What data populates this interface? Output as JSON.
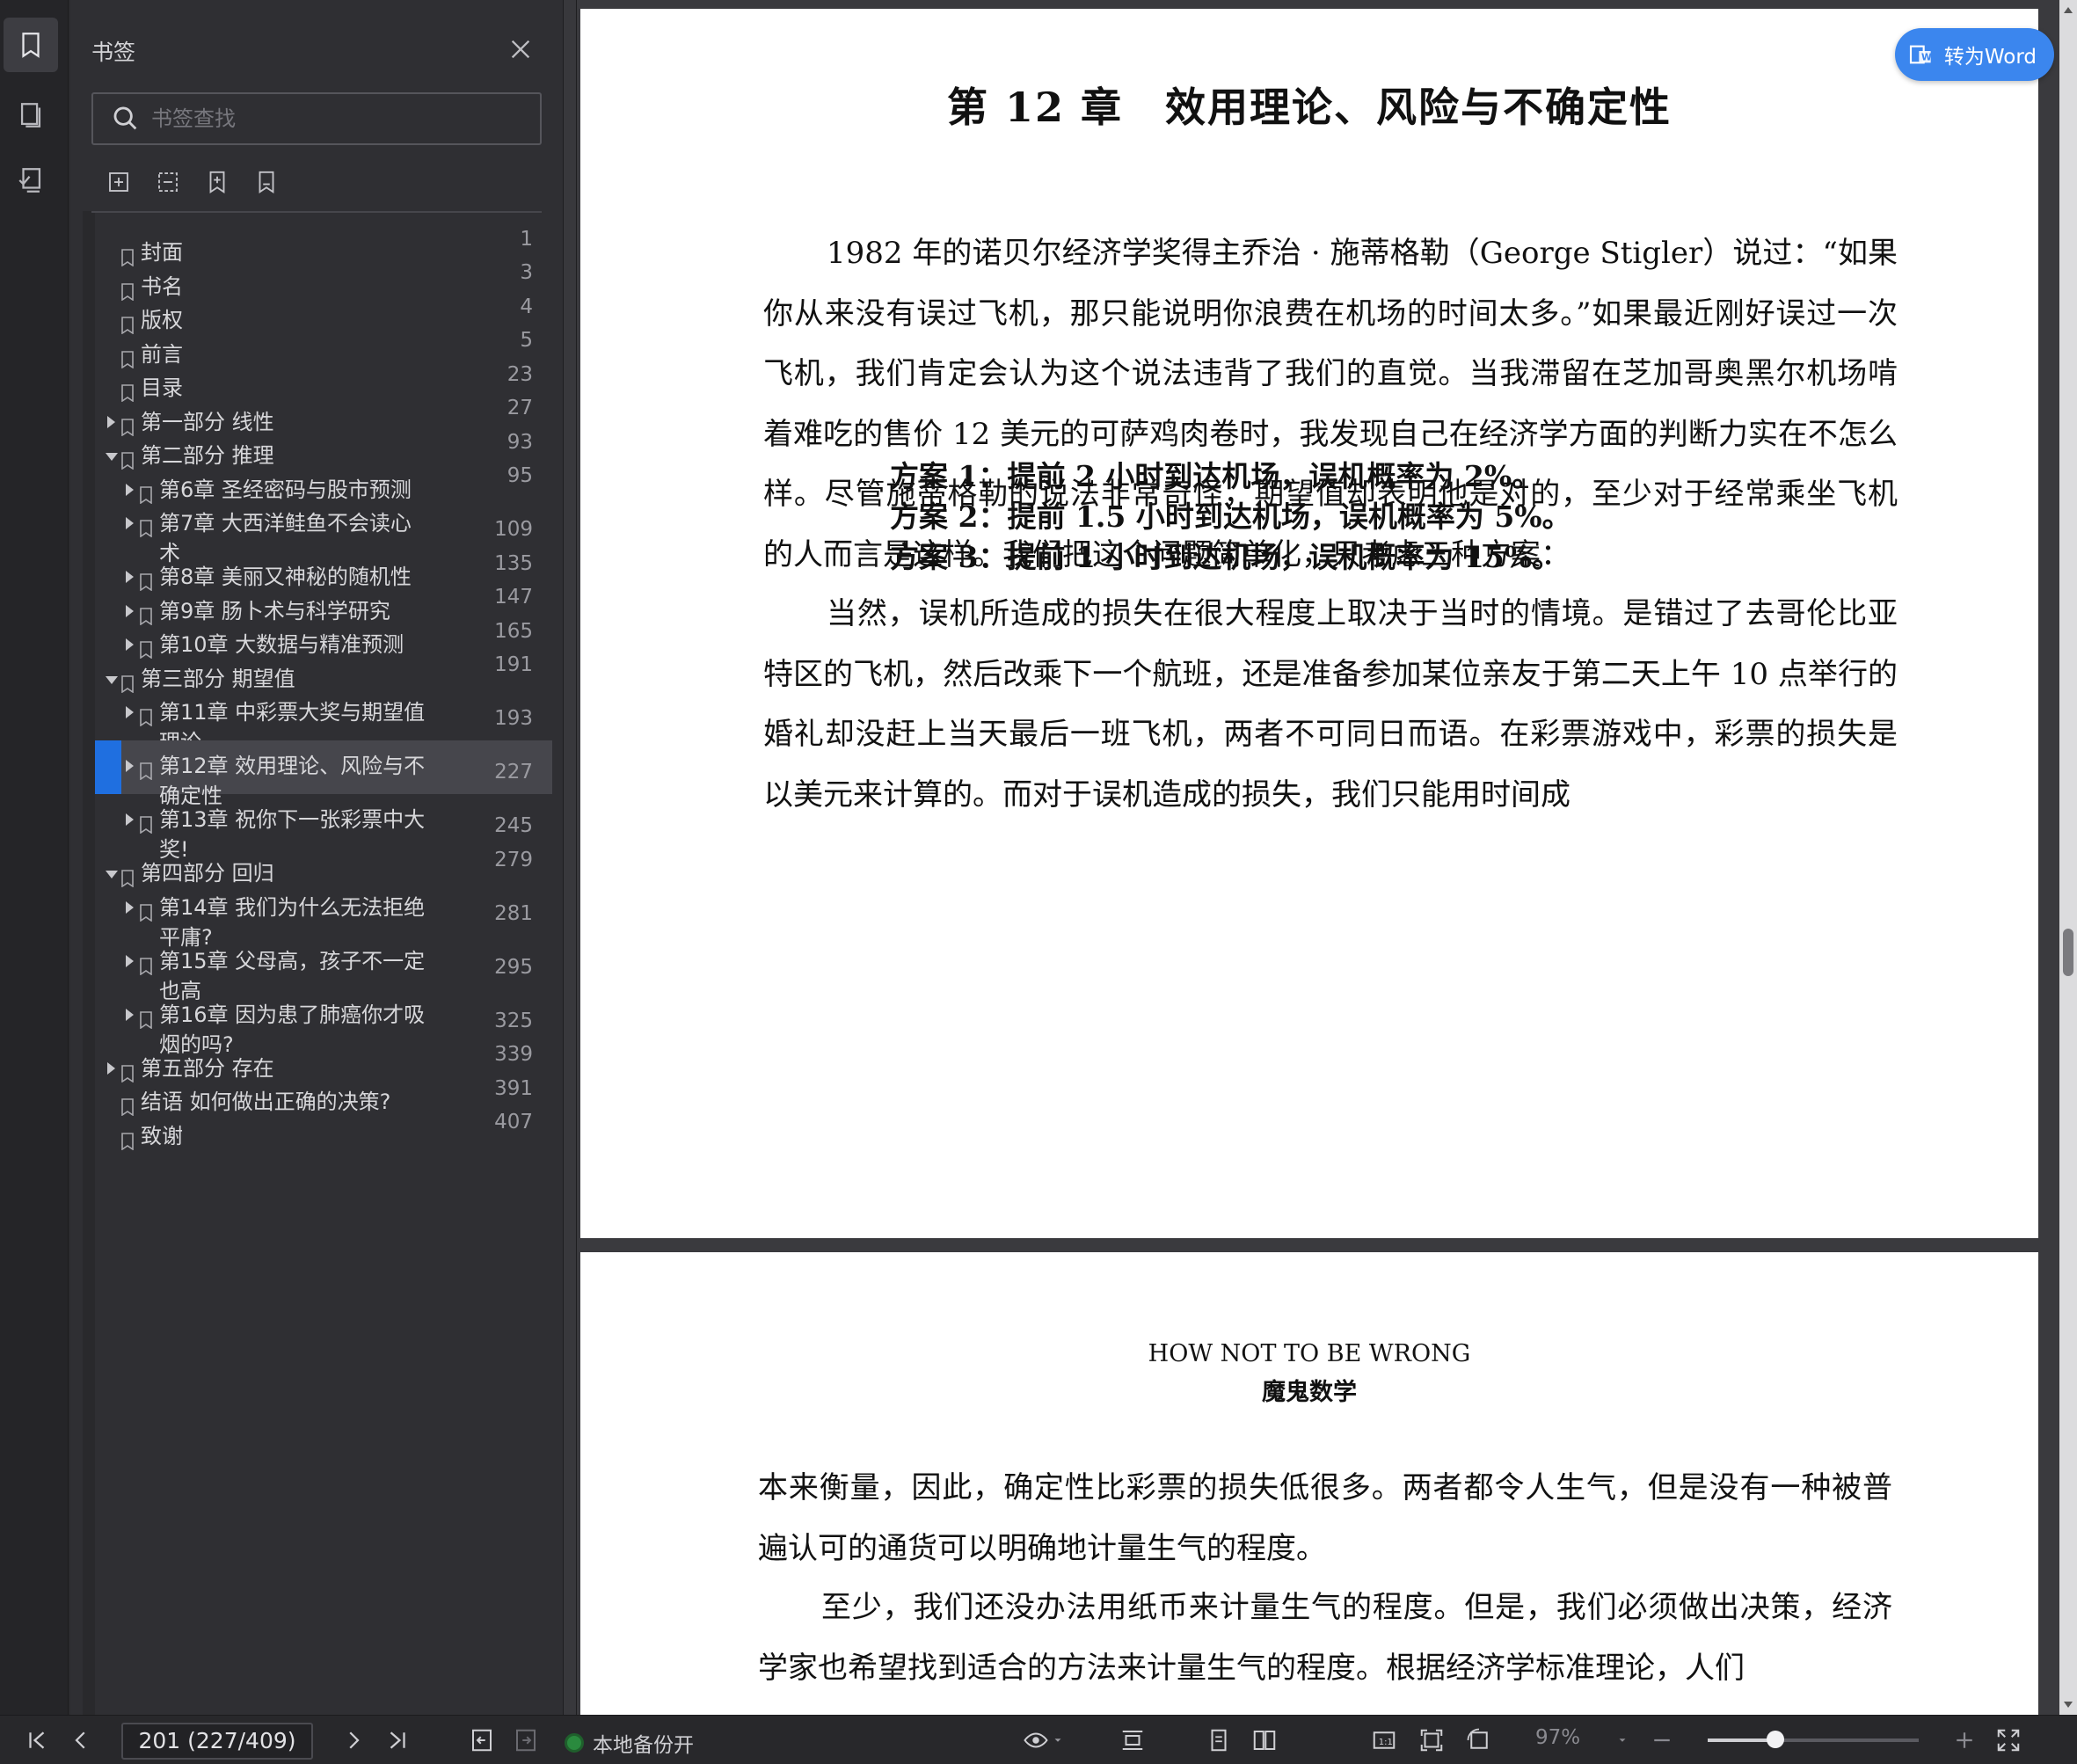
{
  "rail": {
    "items": [
      {
        "name": "bookmark-icon"
      },
      {
        "name": "thumbnail-icon"
      },
      {
        "name": "annotation-icon"
      }
    ]
  },
  "sidebar": {
    "title": "书签",
    "search_placeholder": "书签查找",
    "tools": [
      "expand-all-icon",
      "collapse-all-icon",
      "add-bookmark-icon",
      "bookmark-outline-icon"
    ]
  },
  "toc": [
    {
      "label": "封面",
      "page": "1",
      "level": 0,
      "arrow": "none",
      "height": 58
    },
    {
      "label": "书名",
      "page": "3",
      "level": 0,
      "arrow": "none",
      "height": 38.5
    },
    {
      "label": "版权",
      "page": "4",
      "level": 0,
      "arrow": "none",
      "height": 38.5
    },
    {
      "label": "前言",
      "page": "5",
      "level": 0,
      "arrow": "none",
      "height": 38.5
    },
    {
      "label": "目录",
      "page": "23",
      "level": 0,
      "arrow": "none",
      "height": 38.5
    },
    {
      "label": "第一部分 线性",
      "page": "27",
      "level": 0,
      "arrow": "right",
      "height": 38.5
    },
    {
      "label": "第二部分 推理",
      "page": "93",
      "level": 0,
      "arrow": "down",
      "height": 38.5
    },
    {
      "label": "第6章 圣经密码与股市预测",
      "page": "95",
      "level": 1,
      "arrow": "right",
      "height": 38.5
    },
    {
      "label": "第7章 大西洋鲑鱼不会读心\n术",
      "page": "109",
      "level": 1,
      "arrow": "right",
      "height": 61
    },
    {
      "label": "第8章 美丽又神秘的随机性",
      "page": "135",
      "level": 1,
      "arrow": "right",
      "height": 38.5
    },
    {
      "label": "第9章 肠卜术与科学研究",
      "page": "147",
      "level": 1,
      "arrow": "right",
      "height": 38.5
    },
    {
      "label": "第10章 大数据与精准预测",
      "page": "165",
      "level": 1,
      "arrow": "right",
      "height": 38.5
    },
    {
      "label": "第三部分 期望值",
      "page": "191",
      "level": 0,
      "arrow": "down",
      "height": 38.5
    },
    {
      "label": "第11章 中彩票大奖与期望值\n理论",
      "page": "193",
      "level": 1,
      "arrow": "right",
      "height": 61
    },
    {
      "label": "第12章 效用理论、风险与不\n确定性",
      "page": "227",
      "level": 1,
      "arrow": "right",
      "height": 61,
      "selected": true
    },
    {
      "label": "第13章 祝你下一张彩票中大\n奖!",
      "page": "245",
      "level": 1,
      "arrow": "right",
      "height": 61
    },
    {
      "label": "第四部分 回归",
      "page": "279",
      "level": 0,
      "arrow": "down",
      "height": 38.5
    },
    {
      "label": "第14章 我们为什么无法拒绝\n平庸?",
      "page": "281",
      "level": 1,
      "arrow": "right",
      "height": 61
    },
    {
      "label": "第15章 父母高，孩子不一定\n也高",
      "page": "295",
      "level": 1,
      "arrow": "right",
      "height": 61
    },
    {
      "label": "第16章 因为患了肺癌你才吸\n烟的吗?",
      "page": "325",
      "level": 1,
      "arrow": "right",
      "height": 61
    },
    {
      "label": "第五部分 存在",
      "page": "339",
      "level": 0,
      "arrow": "right",
      "height": 38.5
    },
    {
      "label": "结语 如何做出正确的决策?",
      "page": "391",
      "level": 0,
      "arrow": "none",
      "height": 38.5
    },
    {
      "label": "致谢",
      "page": "407",
      "level": 0,
      "arrow": "none",
      "height": 38.5
    }
  ],
  "document": {
    "convert_button": "转为Word",
    "page1": {
      "title": "第 12 章　效用理论、风险与不确定性",
      "para1": "1982 年的诺贝尔经济学奖得主乔治 · 施蒂格勒（George Stigler）说过：“如果你从来没有误过飞机，那只能说明你浪费在机场的时间太多。”如果最近刚好误过一次飞机，我们肯定会认为这个说法违背了我们的直觉。当我滞留在芝加哥奥黑尔机场啃着难吃的售价 12 美元的可萨鸡肉卷时，我发现自己在经济学方面的判断力实在不怎么样。尽管施蒂格勒的说法非常奇怪，期望值却表明他是对的，至少对于经常乘坐飞机的人而言是这样。我们把这个问题简单化，只考虑三种方案：",
      "plans": [
        "方案 1：提前 2 小时到达机场，误机概率为 2%。",
        "方案 2：提前 1.5 小时到达机场，误机概率为 5%。",
        "方案 3：提前 1 小时到达机场，误机概率为 15%。"
      ],
      "para2": "当然，误机所造成的损失在很大程度上取决于当时的情境。是错过了去哥伦比亚特区的飞机，然后改乘下一个航班，还是准备参加某位亲友于第二天上午 10 点举行的婚礼却没赶上当天最后一班飞机，两者不可同日而语。在彩票游戏中，彩票的损失是以美元来计算的。而对于误机造成的损失，我们只能用时间成"
    },
    "page2": {
      "running_title_en": "HOW NOT TO BE WRONG",
      "running_title_cn": "魔鬼数学",
      "para1": "本来衡量，因此，确定性比彩票的损失低很多。两者都令人生气，但是没有一种被普遍认可的通货可以明确地计量生气的程度。",
      "para2": "至少，我们还没办法用纸币来计量生气的程度。但是，我们必须做出决策，经济学家也希望找到适合的方法来计量生气的程度。根据经济学标准理论，人们"
    }
  },
  "statusbar": {
    "page_indicator": "201 (227/409)",
    "backup_text": "本地备份开",
    "zoom": "97%",
    "zoom_level": 0.32
  }
}
